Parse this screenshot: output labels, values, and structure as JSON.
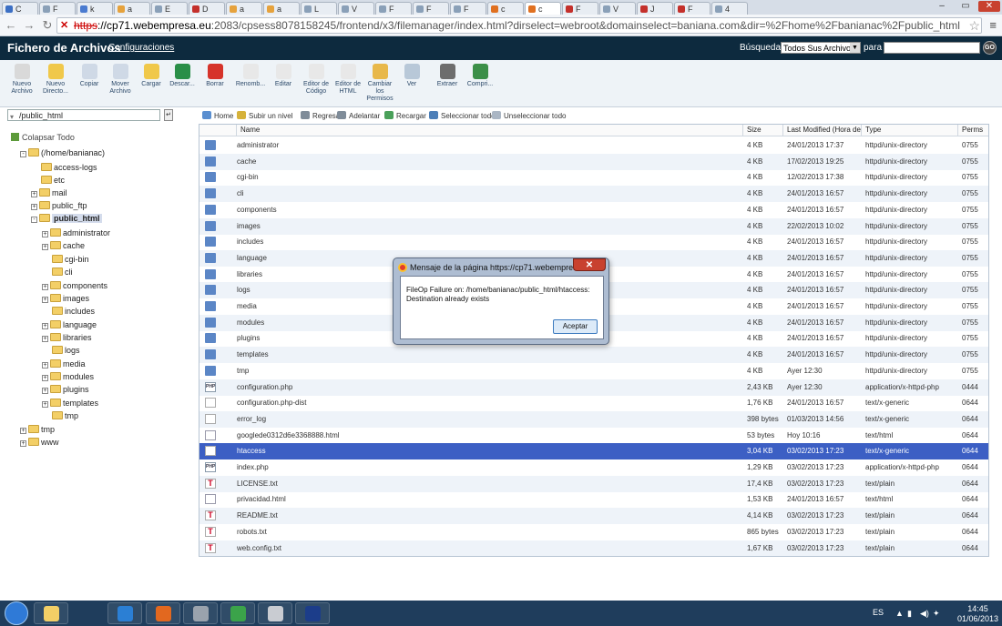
{
  "browser": {
    "tabs": [
      {
        "label": "C",
        "color": "#3b6fc4"
      },
      {
        "label": "F",
        "color": "#8aa0b8"
      },
      {
        "label": "k",
        "color": "#4a7bd0"
      },
      {
        "label": "a",
        "color": "#e6a23c"
      },
      {
        "label": "E",
        "color": "#8aa0b8"
      },
      {
        "label": "D",
        "color": "#c4302b"
      },
      {
        "label": "a",
        "color": "#e6a23c"
      },
      {
        "label": "a",
        "color": "#e6a23c"
      },
      {
        "label": "L",
        "color": "#8aa0b8"
      },
      {
        "label": "V",
        "color": "#8aa0b8"
      },
      {
        "label": "F",
        "color": "#8aa0b8"
      },
      {
        "label": "F",
        "color": "#8aa0b8"
      },
      {
        "label": "F",
        "color": "#8aa0b8"
      },
      {
        "label": "c",
        "color": "#e07020"
      },
      {
        "label": "c",
        "color": "#e07020"
      },
      {
        "label": "F",
        "color": "#c4302b"
      },
      {
        "label": "V",
        "color": "#8aa0b8"
      },
      {
        "label": "J",
        "color": "#c4302b"
      },
      {
        "label": "F",
        "color": "#c4302b"
      },
      {
        "label": "4",
        "color": "#8aa0b8"
      }
    ],
    "url_https": "https",
    "url_domain": "://cp71.webempresa.eu",
    "url_rest": ":2083/cpsess8078158245/frontend/x3/filemanager/index.html?dirselect=webroot&domainselect=baniana.com&dir=%2Fhome%2Fbanianac%2Fpublic_html"
  },
  "header": {
    "title": "Fichero de Archivos",
    "config_link": "Configuraciones",
    "search_label": "Búsqueda",
    "search_scope": "Todos Sus Archivos",
    "para_label": "para",
    "go_label": "GO"
  },
  "toolbar": [
    {
      "label": "Nuevo Archivo",
      "icon": "new-file-icon",
      "color": "#d9d9d9"
    },
    {
      "label": "Nuevo Directo...",
      "icon": "new-folder-icon",
      "color": "#f0c84a"
    },
    {
      "label": "Copiar",
      "icon": "copy-icon",
      "color": "#cfd9e6"
    },
    {
      "label": "Mover Archivo",
      "icon": "move-icon",
      "color": "#cfd9e6"
    },
    {
      "label": "Cargar",
      "icon": "upload-icon",
      "color": "#f0c84a"
    },
    {
      "label": "Descar...",
      "icon": "download-icon",
      "color": "#2a8f48"
    },
    {
      "label": "Borrar",
      "icon": "delete-icon",
      "color": "#d6332a"
    },
    {
      "label": "Renomb...",
      "icon": "rename-icon",
      "color": "#e8e8e8"
    },
    {
      "label": "Editar",
      "icon": "edit-icon",
      "color": "#e8e8e8"
    },
    {
      "label": "Editor de Código",
      "icon": "code-editor-icon",
      "color": "#e8e8e8"
    },
    {
      "label": "Editor de HTML",
      "icon": "html-editor-icon",
      "color": "#e8e8e8"
    },
    {
      "label": "Cambiar los Permisos",
      "icon": "permissions-icon",
      "color": "#e8b84a"
    },
    {
      "label": "Ver",
      "icon": "view-icon",
      "color": "#b8c8d8"
    },
    {
      "label": "Extraer",
      "icon": "extract-icon",
      "color": "#6d6d6d"
    },
    {
      "label": "Compri...",
      "icon": "compress-icon",
      "color": "#3b8f48"
    }
  ],
  "left": {
    "path": "/public_html",
    "collapse_label": "Colapsar Todo",
    "tree": [
      {
        "label": "(/home/banianac)",
        "indent": 0,
        "expander": "-",
        "selected": false
      },
      {
        "label": "access-logs",
        "indent": 1,
        "expander": "",
        "selected": false
      },
      {
        "label": "etc",
        "indent": 1,
        "expander": "",
        "selected": false
      },
      {
        "label": "mail",
        "indent": 1,
        "expander": "+",
        "selected": false
      },
      {
        "label": "public_ftp",
        "indent": 1,
        "expander": "+",
        "selected": false
      },
      {
        "label": "public_html",
        "indent": 1,
        "expander": "-",
        "selected": true
      },
      {
        "label": "administrator",
        "indent": 2,
        "expander": "+",
        "selected": false
      },
      {
        "label": "cache",
        "indent": 2,
        "expander": "+",
        "selected": false
      },
      {
        "label": "cgi-bin",
        "indent": 2,
        "expander": "",
        "selected": false
      },
      {
        "label": "cli",
        "indent": 2,
        "expander": "",
        "selected": false
      },
      {
        "label": "components",
        "indent": 2,
        "expander": "+",
        "selected": false
      },
      {
        "label": "images",
        "indent": 2,
        "expander": "+",
        "selected": false
      },
      {
        "label": "includes",
        "indent": 2,
        "expander": "",
        "selected": false
      },
      {
        "label": "language",
        "indent": 2,
        "expander": "+",
        "selected": false
      },
      {
        "label": "libraries",
        "indent": 2,
        "expander": "+",
        "selected": false
      },
      {
        "label": "logs",
        "indent": 2,
        "expander": "",
        "selected": false
      },
      {
        "label": "media",
        "indent": 2,
        "expander": "+",
        "selected": false
      },
      {
        "label": "modules",
        "indent": 2,
        "expander": "+",
        "selected": false
      },
      {
        "label": "plugins",
        "indent": 2,
        "expander": "+",
        "selected": false
      },
      {
        "label": "templates",
        "indent": 2,
        "expander": "+",
        "selected": false
      },
      {
        "label": "tmp",
        "indent": 2,
        "expander": "",
        "selected": false
      },
      {
        "label": "tmp",
        "indent": 0,
        "expander": "+",
        "selected": false
      },
      {
        "label": "www",
        "indent": 0,
        "expander": "+",
        "selected": false
      }
    ]
  },
  "actions": [
    {
      "label": "Home",
      "icon": "home-icon",
      "color": "#5a8fd0"
    },
    {
      "label": "Subir un nivel",
      "icon": "up-level-icon",
      "color": "#d6b23a"
    },
    {
      "label": "Regresar",
      "icon": "back-icon",
      "color": "#7f8c99"
    },
    {
      "label": "Adelantar",
      "icon": "forward-icon",
      "color": "#7f8c99"
    },
    {
      "label": "Recargar",
      "icon": "reload-icon",
      "color": "#4aa05a"
    },
    {
      "label": "Seleccionar todo",
      "icon": "select-all-icon",
      "color": "#4d7fb8"
    },
    {
      "label": "Unseleccionar todo",
      "icon": "unselect-all-icon",
      "color": "#aab6c4"
    }
  ],
  "table": {
    "columns": [
      "Name",
      "Size",
      "Last Modified (Hora de ve",
      "Type",
      "Perms"
    ],
    "rows": [
      {
        "name": "administrator",
        "size": "4 KB",
        "modified": "24/01/2013 17:37",
        "type": "httpd/unix-directory",
        "perms": "0755",
        "icon": "folder"
      },
      {
        "name": "cache",
        "size": "4 KB",
        "modified": "17/02/2013 19:25",
        "type": "httpd/unix-directory",
        "perms": "0755",
        "icon": "folder"
      },
      {
        "name": "cgi-bin",
        "size": "4 KB",
        "modified": "12/02/2013 17:38",
        "type": "httpd/unix-directory",
        "perms": "0755",
        "icon": "folder"
      },
      {
        "name": "cli",
        "size": "4 KB",
        "modified": "24/01/2013 16:57",
        "type": "httpd/unix-directory",
        "perms": "0755",
        "icon": "folder"
      },
      {
        "name": "components",
        "size": "4 KB",
        "modified": "24/01/2013 16:57",
        "type": "httpd/unix-directory",
        "perms": "0755",
        "icon": "folder"
      },
      {
        "name": "images",
        "size": "4 KB",
        "modified": "22/02/2013 10:02",
        "type": "httpd/unix-directory",
        "perms": "0755",
        "icon": "folder"
      },
      {
        "name": "includes",
        "size": "4 KB",
        "modified": "24/01/2013 16:57",
        "type": "httpd/unix-directory",
        "perms": "0755",
        "icon": "folder"
      },
      {
        "name": "language",
        "size": "4 KB",
        "modified": "24/01/2013 16:57",
        "type": "httpd/unix-directory",
        "perms": "0755",
        "icon": "folder"
      },
      {
        "name": "libraries",
        "size": "4 KB",
        "modified": "24/01/2013 16:57",
        "type": "httpd/unix-directory",
        "perms": "0755",
        "icon": "folder"
      },
      {
        "name": "logs",
        "size": "4 KB",
        "modified": "24/01/2013 16:57",
        "type": "httpd/unix-directory",
        "perms": "0755",
        "icon": "folder"
      },
      {
        "name": "media",
        "size": "4 KB",
        "modified": "24/01/2013 16:57",
        "type": "httpd/unix-directory",
        "perms": "0755",
        "icon": "folder"
      },
      {
        "name": "modules",
        "size": "4 KB",
        "modified": "24/01/2013 16:57",
        "type": "httpd/unix-directory",
        "perms": "0755",
        "icon": "folder"
      },
      {
        "name": "plugins",
        "size": "4 KB",
        "modified": "24/01/2013 16:57",
        "type": "httpd/unix-directory",
        "perms": "0755",
        "icon": "folder"
      },
      {
        "name": "templates",
        "size": "4 KB",
        "modified": "24/01/2013 16:57",
        "type": "httpd/unix-directory",
        "perms": "0755",
        "icon": "folder"
      },
      {
        "name": "tmp",
        "size": "4 KB",
        "modified": "Ayer 12:30",
        "type": "httpd/unix-directory",
        "perms": "0755",
        "icon": "folder"
      },
      {
        "name": "configuration.php",
        "size": "2,43 KB",
        "modified": "Ayer 12:30",
        "type": "application/x-httpd-php",
        "perms": "0444",
        "icon": "php"
      },
      {
        "name": "configuration.php-dist",
        "size": "1,76 KB",
        "modified": "24/01/2013 16:57",
        "type": "text/x-generic",
        "perms": "0644",
        "icon": "txt"
      },
      {
        "name": "error_log",
        "size": "398 bytes",
        "modified": "01/03/2013 14:56",
        "type": "text/x-generic",
        "perms": "0644",
        "icon": "txt"
      },
      {
        "name": "googlede0312d6e3368888.html",
        "size": "53 bytes",
        "modified": "Hoy 10:16",
        "type": "text/html",
        "perms": "0644",
        "icon": "html"
      },
      {
        "name": "htaccess",
        "size": "3,04 KB",
        "modified": "03/02/2013 17:23",
        "type": "text/x-generic",
        "perms": "0644",
        "icon": "txt",
        "selected": true
      },
      {
        "name": "index.php",
        "size": "1,29 KB",
        "modified": "03/02/2013 17:23",
        "type": "application/x-httpd-php",
        "perms": "0644",
        "icon": "php"
      },
      {
        "name": "LICENSE.txt",
        "size": "17,4 KB",
        "modified": "03/02/2013 17:23",
        "type": "text/plain",
        "perms": "0644",
        "icon": "t"
      },
      {
        "name": "privacidad.html",
        "size": "1,53 KB",
        "modified": "24/01/2013 16:57",
        "type": "text/html",
        "perms": "0644",
        "icon": "html"
      },
      {
        "name": "README.txt",
        "size": "4,14 KB",
        "modified": "03/02/2013 17:23",
        "type": "text/plain",
        "perms": "0644",
        "icon": "t"
      },
      {
        "name": "robots.txt",
        "size": "865 bytes",
        "modified": "03/02/2013 17:23",
        "type": "text/plain",
        "perms": "0644",
        "icon": "t"
      },
      {
        "name": "web.config.txt",
        "size": "1,67 KB",
        "modified": "03/02/2013 17:23",
        "type": "text/plain",
        "perms": "0644",
        "icon": "t"
      }
    ]
  },
  "dialog": {
    "title": "Mensaje de la página https://cp71.webempresa.eu...",
    "close_glyph": "✕",
    "message_line1": "FileOp Failure on: /home/banianac/public_html/htaccess:",
    "message_line2": "Destination already exists",
    "ok_label": "Aceptar"
  },
  "taskbar": {
    "apps": [
      {
        "icon": "explorer-folder-icon",
        "color": "#f3cf66"
      },
      {
        "icon": "internet-explorer-icon",
        "color": "#2b7fd4"
      },
      {
        "icon": "firefox-icon",
        "color": "#e2681f"
      },
      {
        "icon": "tools-icon",
        "color": "#9aa3ad"
      },
      {
        "icon": "chrome-icon",
        "color": "#3ba34a"
      },
      {
        "icon": "file-manager-icon",
        "color": "#c9ccd2"
      },
      {
        "icon": "photoshop-icon",
        "color": "#1c3d8a"
      }
    ],
    "lang": "ES",
    "time": "14:45",
    "date": "01/06/2013"
  }
}
